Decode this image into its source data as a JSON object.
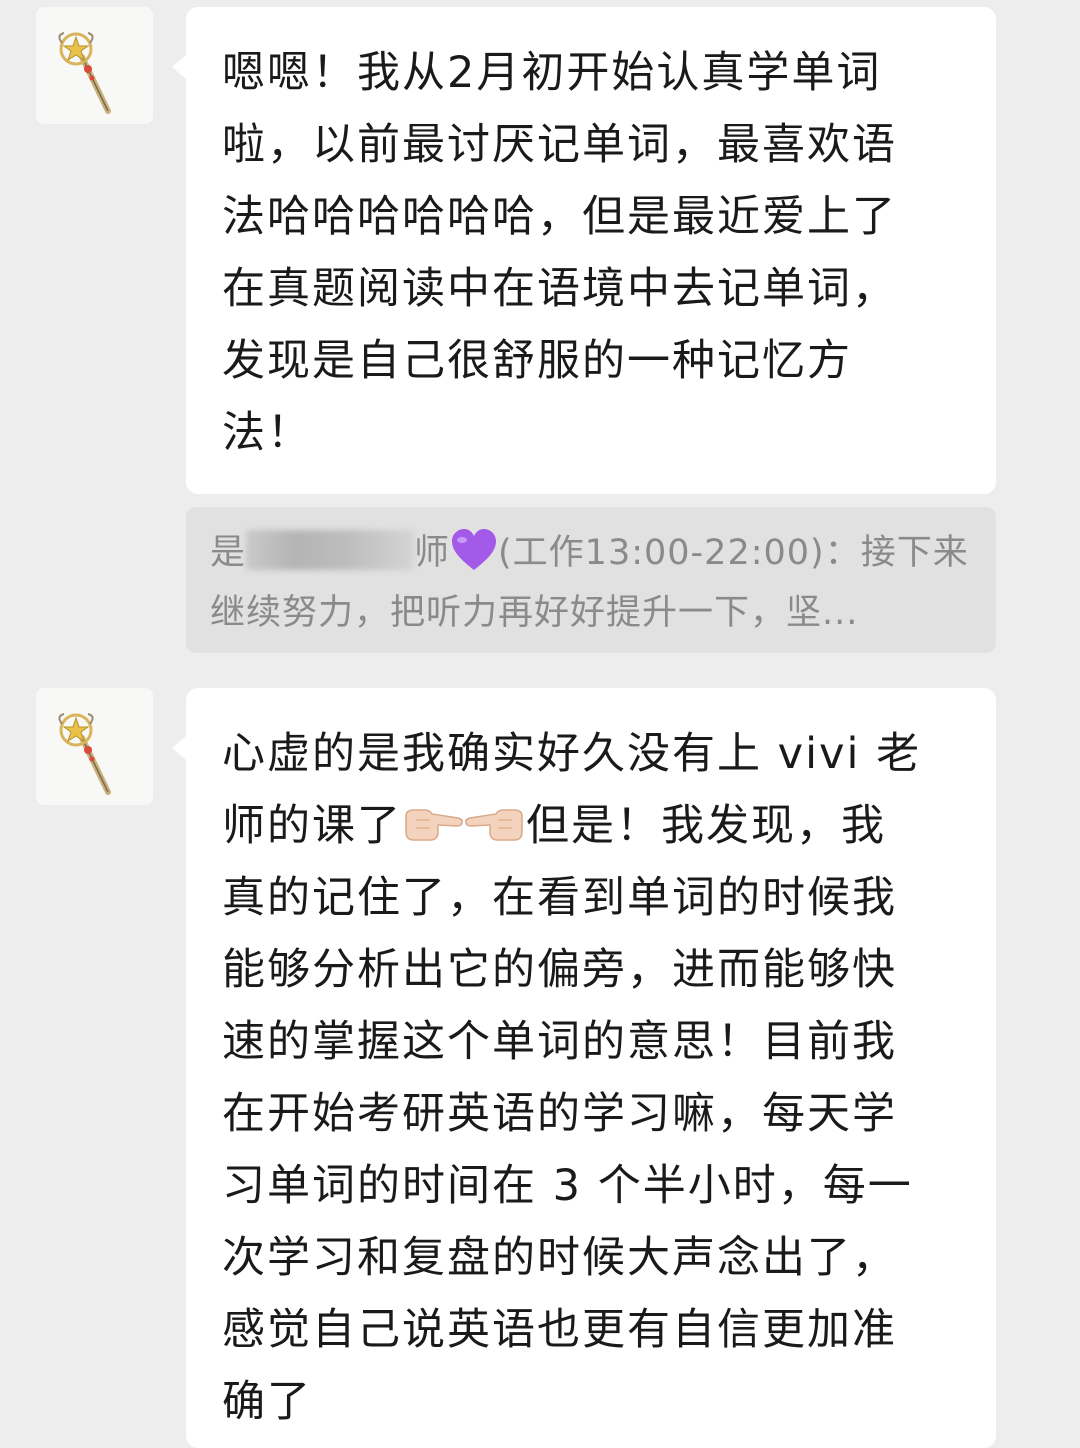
{
  "colors": {
    "background": "#ededed",
    "bubble": "#ffffff",
    "quote_background": "#e1e1e1",
    "quote_text": "#8a8a8a",
    "heart": "#a45ae8"
  },
  "icons": {
    "avatar": "magic-wand-icon",
    "heart": "purple-heart-icon",
    "hand_right": "pointing-right-hand-icon",
    "hand_left": "pointing-left-hand-icon"
  },
  "messages": [
    {
      "text": "嗯嗯！我从2月初开始认真学单词\n啦，以前最讨厌记单词，最喜欢语\n法哈哈哈哈哈哈，但是最近爱上了\n在真题阅读中在语境中去记单词，\n发现是自己很舒服的一种记忆方\n法！"
    },
    {
      "text_before_emoji": "心虚的是我确实好久没有上 vivi 老\n师的课了",
      "text_after_emoji": "但是！我发现，我\n真的记住了，在看到单词的时候我\n能够分析出它的偏旁，进而能够快\n速的掌握这个单词的意思！目前我\n在开始考研英语的学习嘛，每天学\n习单词的时间在 3 个半小时，每一\n次学习和复盘的时候大声念出了，\n感觉自己说英语也更有自信更加准\n确了"
    }
  ],
  "quote": {
    "name_prefix": "是",
    "name_suffix": "师",
    "line1_rest": "(工作13:00-22:00)：接下来",
    "line2": "继续努力，把听力再好好提升一下，坚..."
  }
}
